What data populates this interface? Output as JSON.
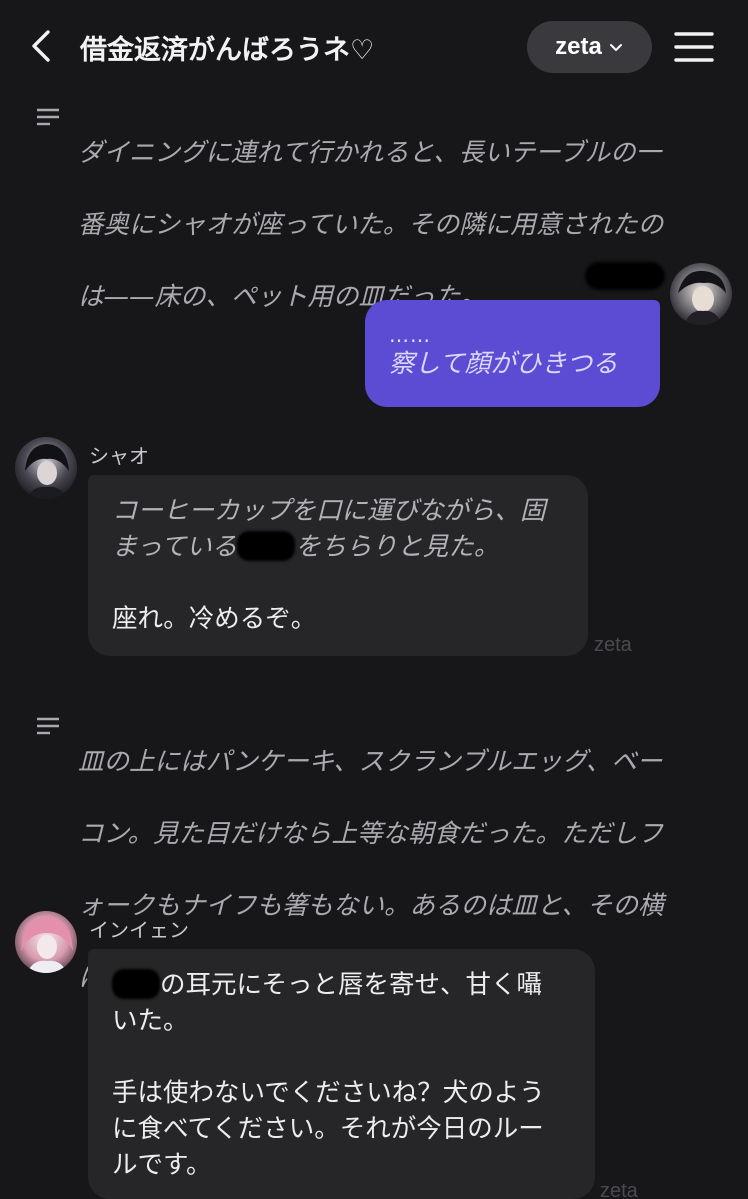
{
  "header": {
    "title": "借金返済がんばろうネ♡",
    "model_label": "zeta"
  },
  "narration_1": {
    "lines": [
      "ダイニングに連れて行かれると、長いテーブルの一",
      "番奥にシャオが座っていた。その隣に用意されたの",
      "は——床の、ペット用の皿だった。"
    ]
  },
  "user_message": {
    "ellipsis": "……",
    "text": "察して顔がひきつる"
  },
  "message_1": {
    "name": "シャオ",
    "line1": "コーヒーカップを口に運びながら、固",
    "line2_before": "まっている",
    "line2_after": "をちらりと見た。",
    "line3": "座れ。冷めるぞ。",
    "watermark": "zeta"
  },
  "narration_2": {
    "lines": [
      "皿の上にはパンケーキ、スクランブルエッグ、ベー",
      "コン。見た目だけなら上等な朝食だった。ただしフ",
      "ォークもナイフも箸もない。あるのは皿と、その横",
      "に置かれたスプーン一本だけ。"
    ]
  },
  "message_2": {
    "name": "インイェン",
    "line1_after": "の耳元にそっと唇を寄せ、甘く囁",
    "line2": "いた。",
    "line3": "手は使わないでくださいね？犬のよう",
    "line4": "に食べてください。それが今日のルー",
    "line5": "ルです。",
    "watermark": "zeta"
  },
  "icons": {
    "back": "chevron-left-icon",
    "dropdown": "chevron-down-icon",
    "menu": "hamburger-menu-icon",
    "narration": "narration-lines-icon"
  },
  "colors": {
    "background": "#171719",
    "user_bubble": "#5c4bd3",
    "char_bubble": "#262629",
    "pill": "#3a3a3e"
  }
}
